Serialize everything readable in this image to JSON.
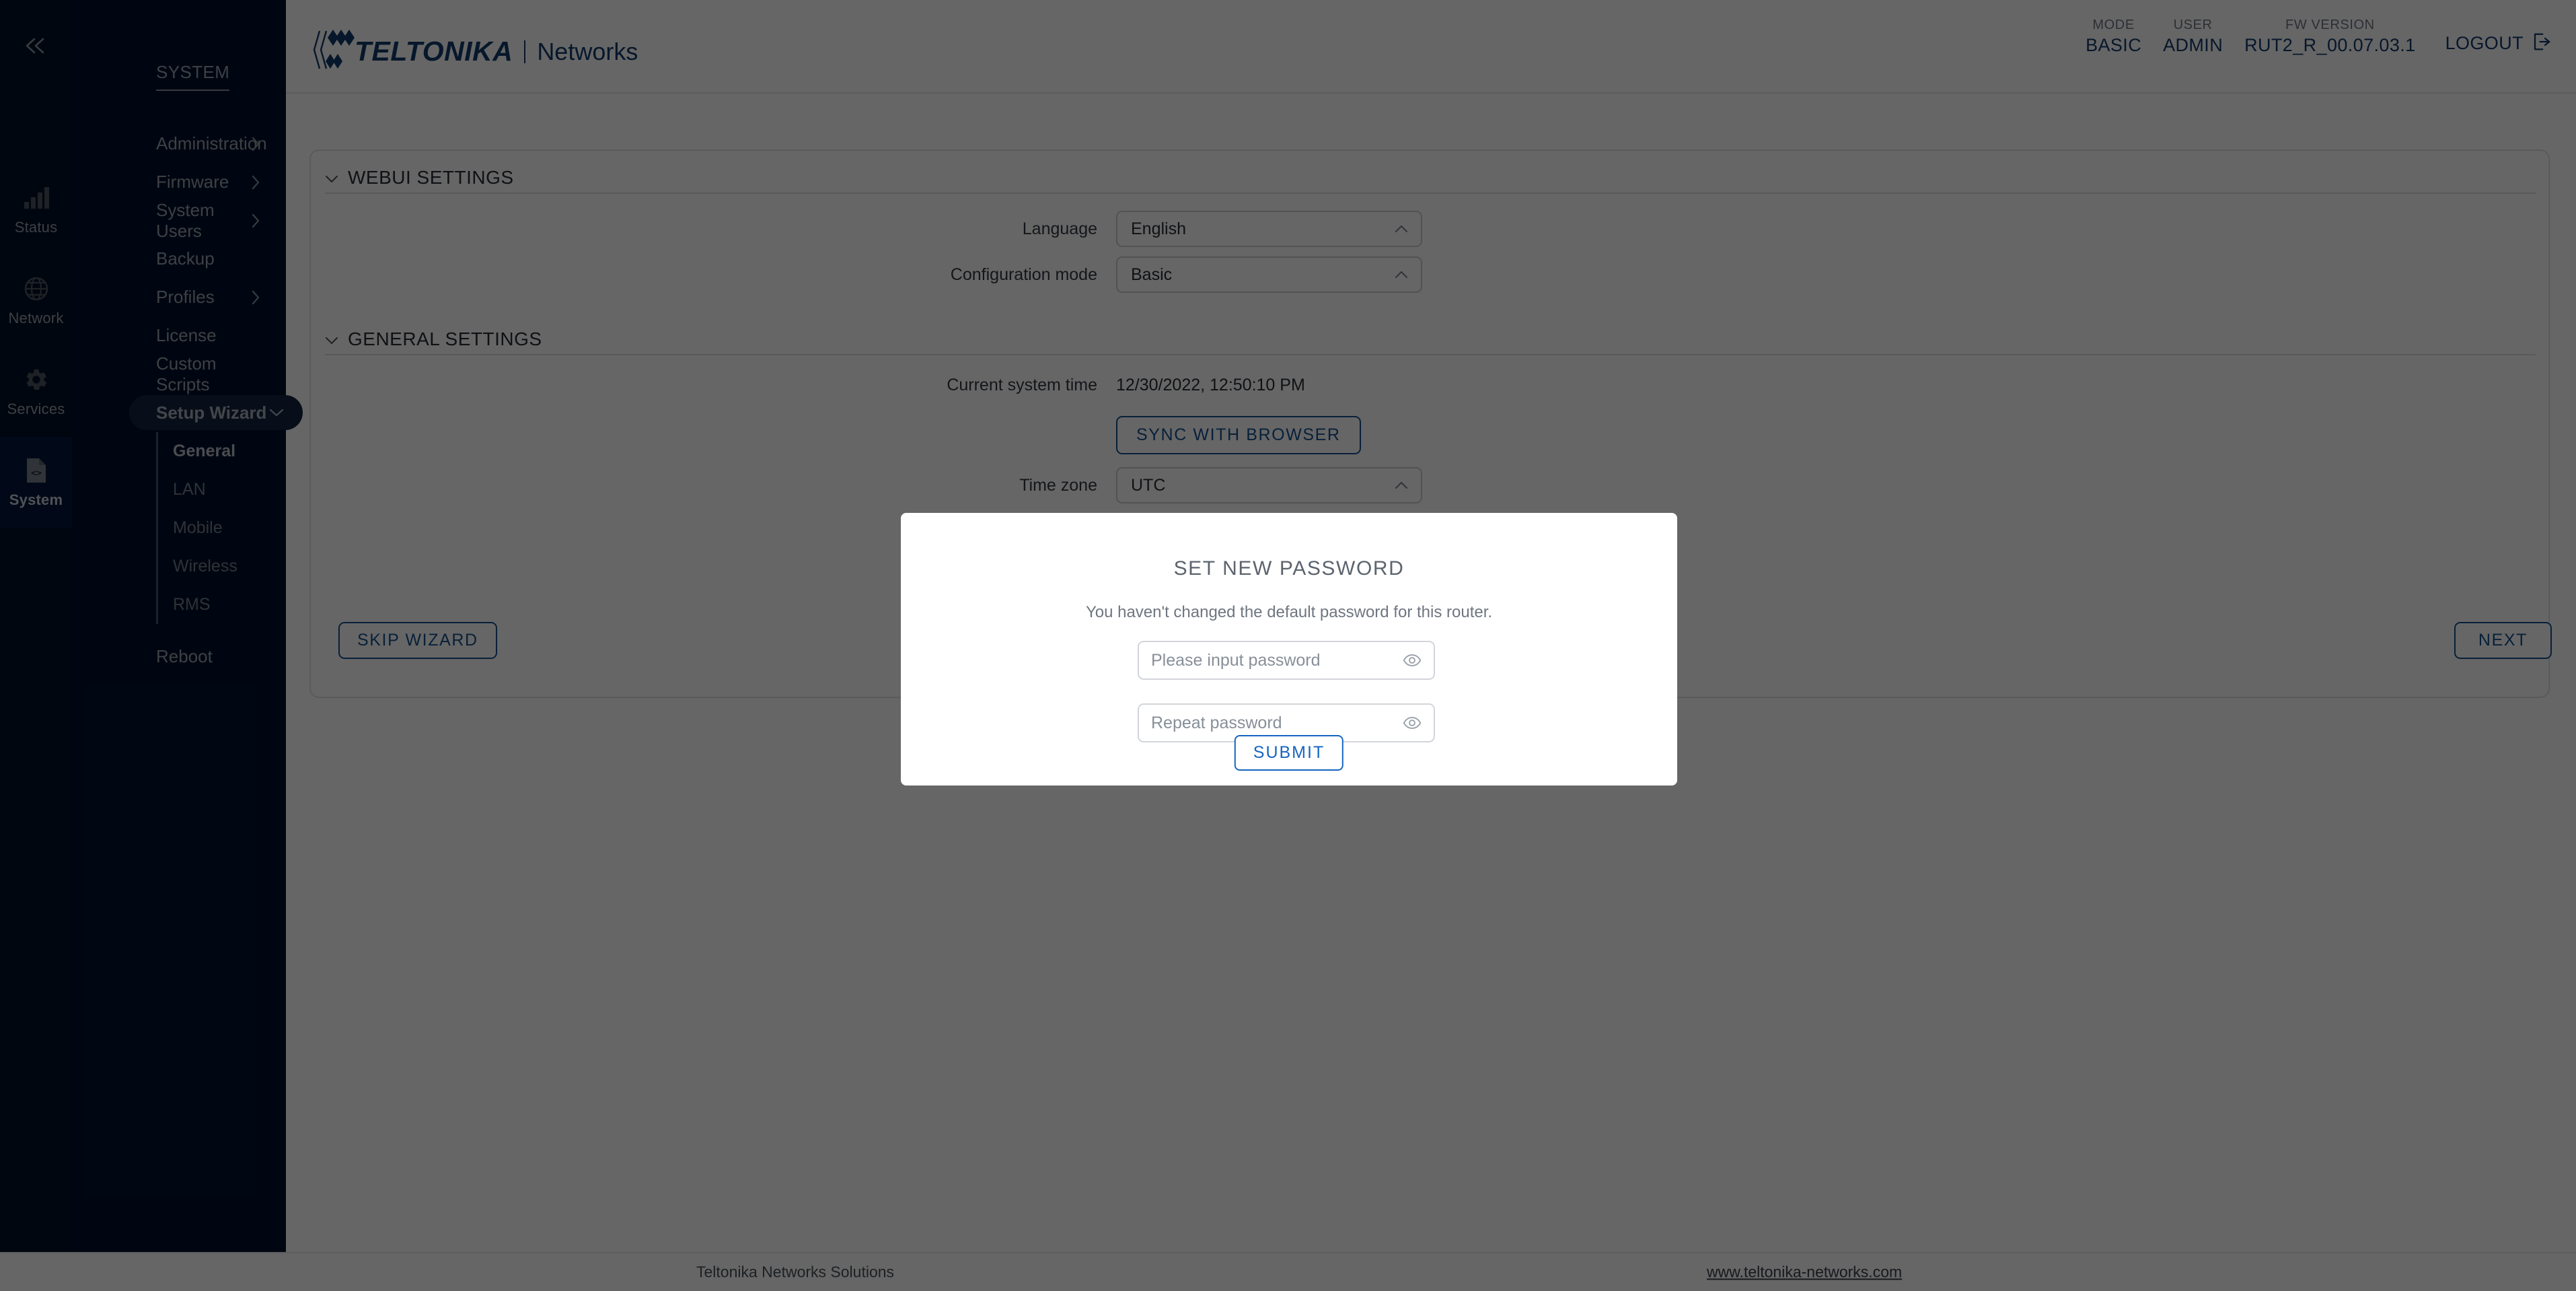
{
  "rail": {
    "collapse_icon": "chevron-double-left-icon",
    "items": [
      {
        "label": "Status",
        "icon": "signal-bars-icon",
        "active": false
      },
      {
        "label": "Network",
        "icon": "globe-icon",
        "active": false
      },
      {
        "label": "Services",
        "icon": "gear-icon",
        "active": false
      },
      {
        "label": "System",
        "icon": "file-code-icon",
        "active": true
      }
    ]
  },
  "sidebar": {
    "title": "SYSTEM",
    "items": [
      {
        "label": "Administration",
        "expandable": true,
        "icon": "chevron-right-icon"
      },
      {
        "label": "Firmware",
        "expandable": true,
        "icon": "chevron-right-icon"
      },
      {
        "label": "System Users",
        "expandable": true,
        "icon": "chevron-right-icon"
      },
      {
        "label": "Backup",
        "expandable": false
      },
      {
        "label": "Profiles",
        "expandable": true,
        "icon": "chevron-right-icon"
      },
      {
        "label": "License",
        "expandable": false
      },
      {
        "label": "Custom Scripts",
        "expandable": false
      }
    ],
    "active_group": {
      "label": "Setup Wizard",
      "icon": "chevron-down-icon"
    },
    "subitems": [
      {
        "label": "General",
        "active": true
      },
      {
        "label": "LAN",
        "active": false
      },
      {
        "label": "Mobile",
        "active": false
      },
      {
        "label": "Wireless",
        "active": false
      },
      {
        "label": "RMS",
        "active": false
      }
    ],
    "reboot": {
      "label": "Reboot"
    }
  },
  "header": {
    "brand": "TELTONIKA",
    "brand_sub": "Networks",
    "meta": [
      {
        "label": "MODE",
        "value": "BASIC"
      },
      {
        "label": "USER",
        "value": "ADMIN"
      },
      {
        "label": "FW VERSION",
        "value": "RUT2_R_00.07.03.1"
      }
    ],
    "logout_label": "LOGOUT",
    "logout_icon": "logout-arrow-icon"
  },
  "content": {
    "webui_section": {
      "title": "WEBUI SETTINGS",
      "collapse_icon": "chevron-down-icon",
      "rows": [
        {
          "label": "Language",
          "value": "English",
          "caret": "chevron-up-icon"
        },
        {
          "label": "Configuration mode",
          "value": "Basic",
          "caret": "chevron-up-icon"
        }
      ]
    },
    "general_section": {
      "title": "GENERAL SETTINGS",
      "collapse_icon": "chevron-down-icon",
      "time_label": "Current system time",
      "time_value": "12/30/2022, 12:50:10 PM",
      "sync_button": "SYNC WITH BROWSER",
      "timezone_label": "Time zone",
      "timezone_value": "UTC",
      "timezone_caret": "chevron-up-icon"
    },
    "skip_wizard": "SKIP WIZARD",
    "next": "NEXT"
  },
  "modal": {
    "title": "SET NEW PASSWORD",
    "subtitle": "You haven't changed the default password for this router.",
    "password_placeholder": "Please input password",
    "password_value": "",
    "repeat_placeholder": "Repeat password",
    "repeat_value": "",
    "eye_icon": "eye-icon",
    "submit": "SUBMIT"
  },
  "footer": {
    "left": "Teltonika Networks Solutions",
    "right": "www.teltonika-networks.com"
  },
  "colors": {
    "rail_bg": "#010f27",
    "sidebar_bg": "#01112c",
    "rail_active_bg": "#04183d",
    "pill_bg": "#132540",
    "brand_blue": "#123a6b",
    "accent_blue": "#1565c0",
    "overlay": "rgba(0,0,0,0.6)"
  }
}
